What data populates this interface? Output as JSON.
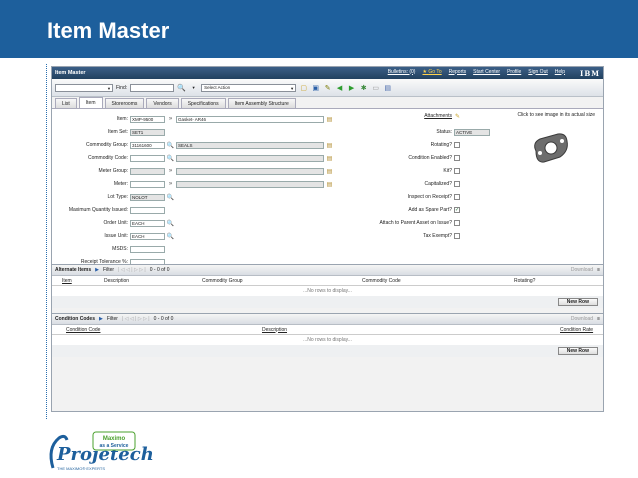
{
  "slide": {
    "title": "Item Master"
  },
  "app": {
    "title": "Item Master",
    "links": [
      "Bulletins: (0)",
      "Go To",
      "Reports",
      "Start Center",
      "Profile",
      "Sign Out",
      "Help"
    ],
    "brand": "IBM"
  },
  "toolbar": {
    "find_label": "Find:",
    "action_placeholder": "Select Action"
  },
  "tabs": [
    "List",
    "Item",
    "Storerooms",
    "Vendors",
    "Specifications",
    "Item Assembly Structure"
  ],
  "form": {
    "item_label": "Item:",
    "item_value": "XMP-9500",
    "item_desc": "Gasket- AR46",
    "itemset_label": "Item Set:",
    "itemset_value": "SET1",
    "commodity_group_label": "Commodity Group:",
    "commodity_group_value": "31161600",
    "commodity_group_desc": "SEALS",
    "commodity_code_label": "Commodity Code:",
    "meter_group_label": "Meter Group:",
    "meter_label": "Meter:",
    "lot_type_label": "Lot Type:",
    "lot_type_value": "NOLOT",
    "max_qty_label": "Maximum Quantity Issued:",
    "order_unit_label": "Order Unit:",
    "order_unit_value": "EACH",
    "issue_unit_label": "Issue Unit:",
    "issue_unit_value": "EACH",
    "msds_label": "MSDS:",
    "receipt_tol_label": "Receipt Tolerance %:",
    "attachments_label": "Attachments",
    "status_label": "Status:",
    "status_value": "ACTIVE",
    "rotating_label": "Rotating?",
    "condition_enabled_label": "Condition Enabled?",
    "kit_label": "Kit?",
    "capitalized_label": "Capitalized?",
    "inspect_label": "Inspect on Receipt?",
    "spare_label": "Add as Spare Part?",
    "attach_parent_label": "Attach to Parent Asset on Issue?",
    "tax_exempt_label": "Tax Exempt?",
    "image_note": "Click to see image in its actual size"
  },
  "alternate_items": {
    "title": "Alternate Items",
    "filter": "Filter",
    "count": "0 - 0 of 0",
    "download": "Download",
    "columns": [
      "Item",
      "Description",
      "Commodity Group",
      "Commodity Code",
      "Rotating?"
    ],
    "empty": "...No rows to display...",
    "new_row": "New Row"
  },
  "condition_codes": {
    "title": "Condition Codes",
    "filter": "Filter",
    "count": "0 - 0 of 0",
    "download": "Download",
    "columns": [
      "Condition Code",
      "Description",
      "Condition Rate"
    ],
    "empty": "...No rows to display...",
    "new_row": "New Row"
  },
  "logo": {
    "name": "Projetech",
    "tagline": "THE MAXIMO® EXPERTS",
    "badge_line1": "Maximo",
    "badge_line2": "as a Service"
  },
  "colors": {
    "header_blue": "#1d5f9c",
    "titlebar": "#2c4c6e",
    "badge_green": "#4aa02c"
  }
}
